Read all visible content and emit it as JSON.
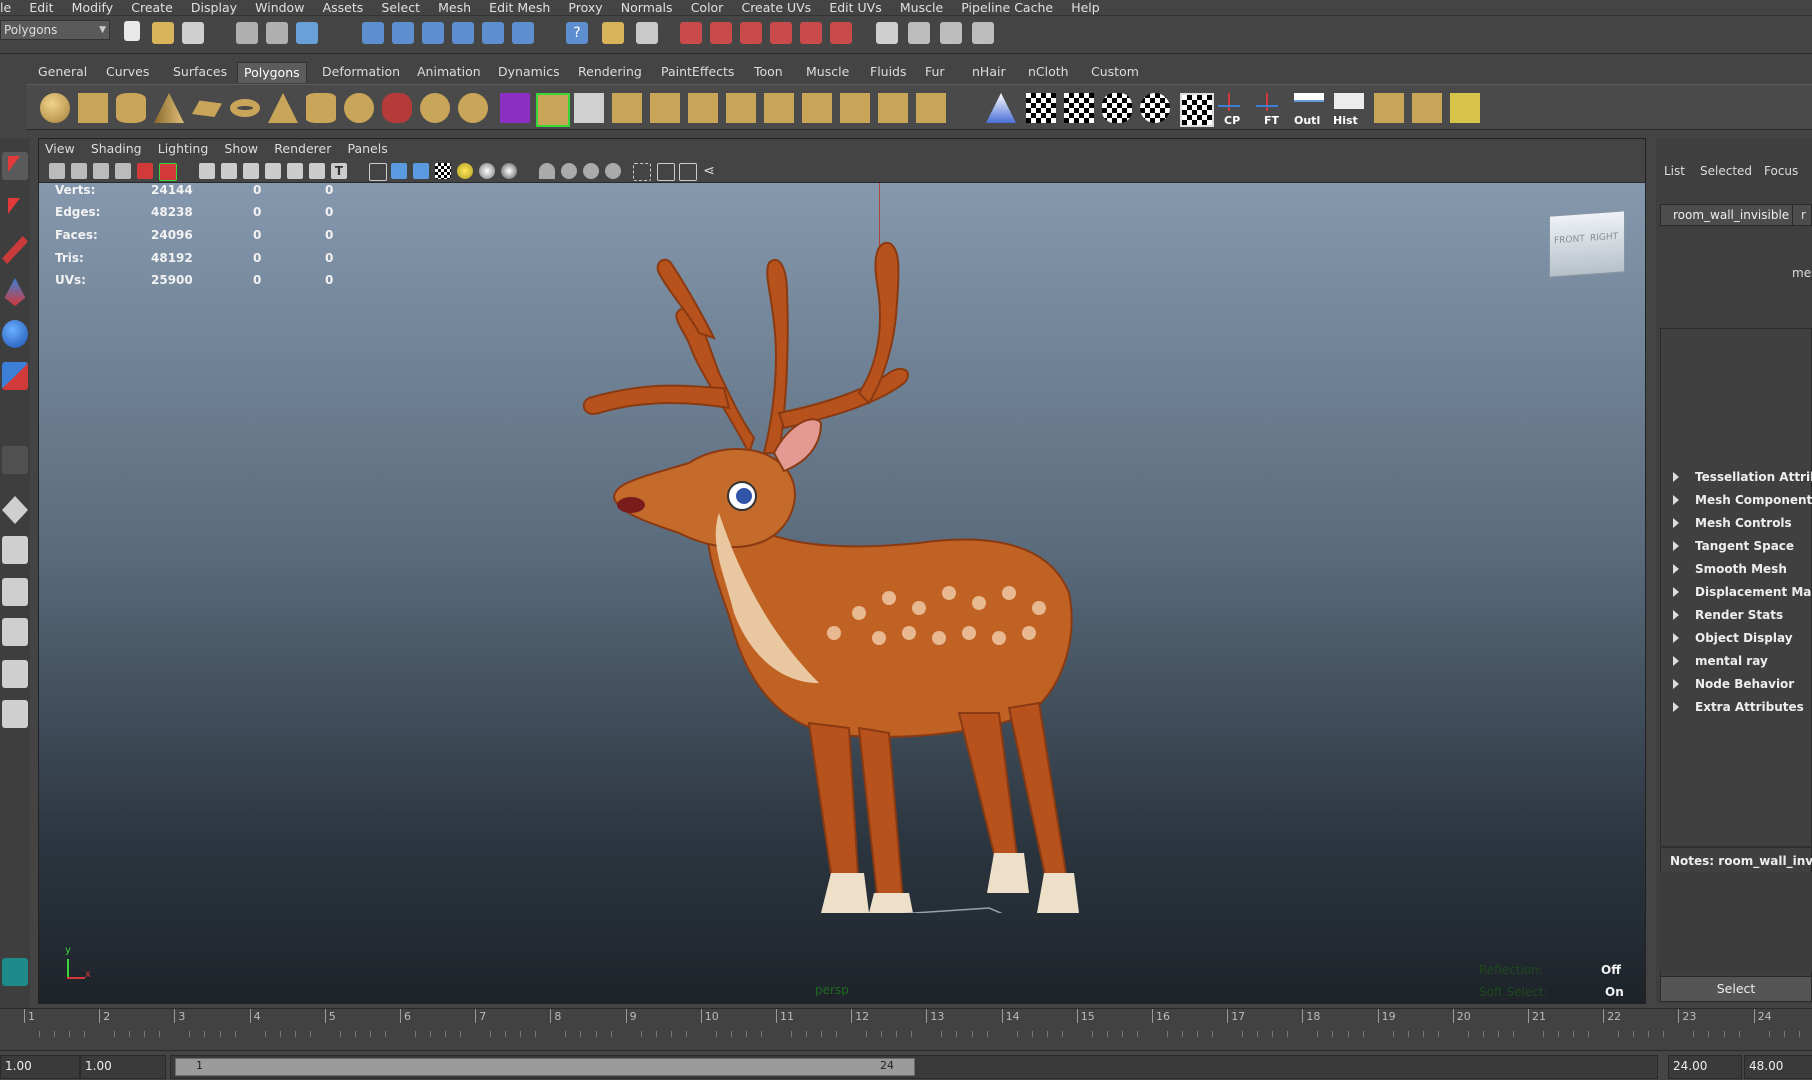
{
  "menubar": {
    "items": [
      "le",
      "Edit",
      "Modify",
      "Create",
      "Display",
      "Window",
      "Assets",
      "Select",
      "Mesh",
      "Edit Mesh",
      "Proxy",
      "Normals",
      "Color",
      "Create UVs",
      "Edit UVs",
      "Muscle",
      "Pipeline Cache",
      "Help"
    ]
  },
  "status": {
    "mode": "Polygons"
  },
  "shelf": {
    "tabs": [
      "General",
      "Curves",
      "Surfaces",
      "Polygons",
      "Deformation",
      "Animation",
      "Dynamics",
      "Rendering",
      "PaintEffects",
      "Toon",
      "Muscle",
      "Fluids",
      "Fur",
      "nHair",
      "nCloth",
      "Custom"
    ],
    "active_tab": "Polygons",
    "labels": {
      "cp": "CP",
      "ft": "FT",
      "outl": "Outl",
      "hist": "Hist"
    }
  },
  "viewport": {
    "menu": [
      "View",
      "Shading",
      "Lighting",
      "Show",
      "Renderer",
      "Panels"
    ],
    "hud_stats": [
      {
        "label": "Verts:",
        "v1": "24144",
        "v2": "0",
        "v3": "0"
      },
      {
        "label": "Edges:",
        "v1": "48238",
        "v2": "0",
        "v3": "0"
      },
      {
        "label": "Faces:",
        "v1": "24096",
        "v2": "0",
        "v3": "0"
      },
      {
        "label": "Tris:",
        "v1": "48192",
        "v2": "0",
        "v3": "0"
      },
      {
        "label": "UVs:",
        "v1": "25900",
        "v2": "0",
        "v3": "0"
      }
    ],
    "viewcube": {
      "front": "FRONT",
      "right": "RIGHT"
    },
    "camera": "persp",
    "reflection_label": "Reflection:",
    "reflection_value": "Off",
    "softselect_label": "Soft Select:",
    "softselect_value": "On",
    "axis": {
      "y": "y",
      "x": "x"
    }
  },
  "channelbox": {
    "tabs": [
      "List",
      "Selected",
      "Focus"
    ],
    "node_name": "room_wall_invisible",
    "node_tab_partial": "r",
    "shape_partial": "mes",
    "attributes": [
      "Tessellation Attributes",
      "Mesh Component Display",
      "Mesh Controls",
      "Tangent Space",
      "Smooth Mesh",
      "Displacement Map",
      "Render Stats",
      "Object Display",
      "mental ray",
      "Node Behavior",
      "Extra Attributes"
    ],
    "notes_label": "Notes:  room_wall_invisible",
    "select_button": "Select"
  },
  "timeline": {
    "ticks": [
      "1",
      "2",
      "3",
      "4",
      "5",
      "6",
      "7",
      "8",
      "9",
      "10",
      "11",
      "12",
      "13",
      "14",
      "15",
      "16",
      "17",
      "18",
      "19",
      "20",
      "21",
      "22",
      "23",
      "24"
    ]
  },
  "range": {
    "start_time": "1.00",
    "playback_start": "1.00",
    "range_start_label": "1",
    "range_end_label": "24",
    "playback_end": "24.00",
    "end_time": "48.00"
  },
  "colors": {
    "accent_red": "#d23a3a",
    "accent_blue": "#3b7fd6",
    "hud_text": "#f2f2f2",
    "viewport_top": "#8598ad",
    "viewport_bottom": "#1d2329"
  }
}
